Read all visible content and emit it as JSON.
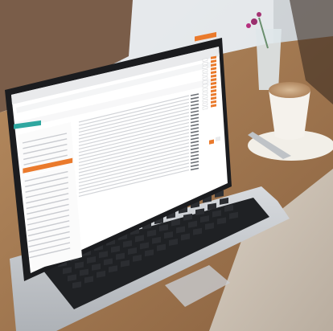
{
  "photo": {
    "subject": "laptop-on-cafe-table",
    "palette": {
      "wall": "#cfd4d8",
      "window_light": "#eef1f3",
      "table": "#a9825a",
      "table_dark": "#7e5a3a",
      "laptop_body": "#c9ccd0",
      "laptop_frame": "#1b1c1f",
      "keyboard": "#202225",
      "cup": "#f4f1ea",
      "coffee": "#b58b63",
      "sweater": "#cfc4b6",
      "accent": "#ea7a2c",
      "accent_teal": "#2fa7a0"
    }
  },
  "screen": {
    "left_panel_items": 22,
    "table_rows": 23,
    "side_rows": 14
  }
}
